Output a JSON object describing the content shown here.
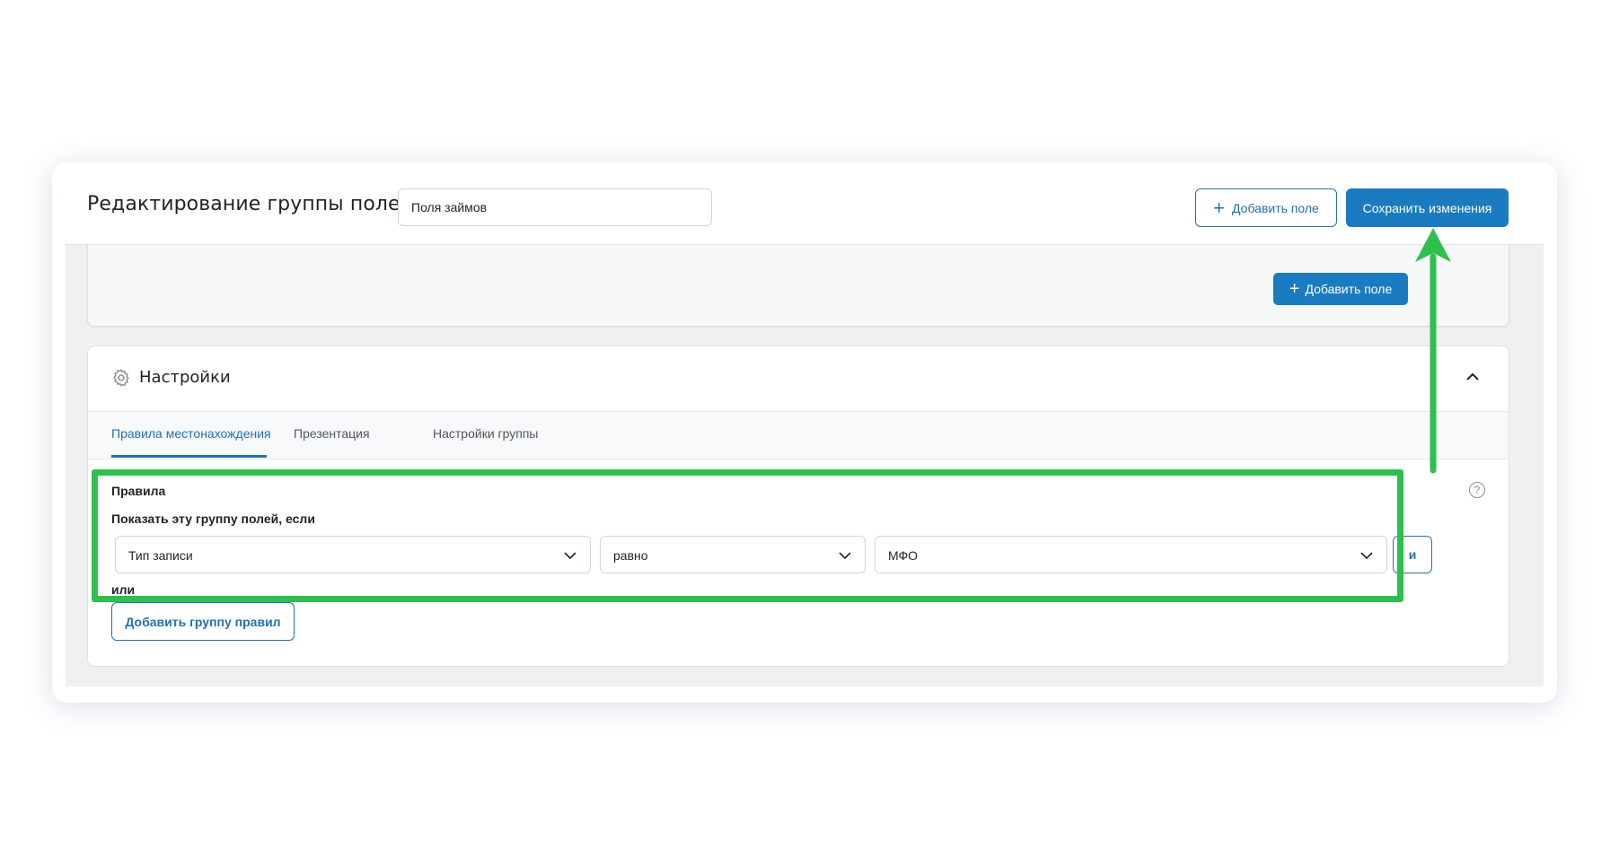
{
  "header": {
    "title": "Редактирование группы полей",
    "title_input_value": "Поля займов",
    "add_field_label": "Добавить поле",
    "save_label": "Сохранить изменения"
  },
  "fields_panel": {
    "add_field_label": "Добавить поле"
  },
  "settings": {
    "title": "Настройки",
    "tabs": [
      {
        "label": "Правила местонахождения",
        "active": true
      },
      {
        "label": "Презентация",
        "active": false
      },
      {
        "label": "Настройки группы",
        "active": false
      }
    ],
    "rules_label": "Правила",
    "rules_sub": "Показать эту группу полей, если",
    "rule": {
      "param": "Тип записи",
      "operator": "равно",
      "value": "МФО"
    },
    "and_label": "и",
    "or_label": "или",
    "add_group_label": "Добавить группу правил",
    "help_glyph": "?"
  },
  "colors": {
    "accent": "#2271b1",
    "primary_button": "#1a7bc0",
    "highlight": "#2fbf4e"
  },
  "icons": [
    "plus-icon",
    "gear-icon",
    "chevron-up-icon",
    "chevron-down-icon",
    "help-icon"
  ]
}
